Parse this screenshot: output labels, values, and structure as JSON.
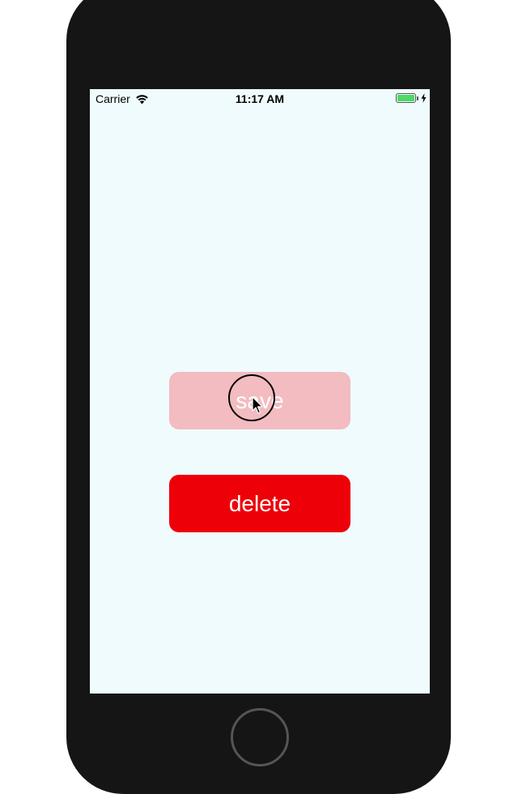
{
  "status_bar": {
    "carrier": "Carrier",
    "time": "11:17 AM",
    "icons": [
      "wifi-icon",
      "battery-icon",
      "charging-bolt-icon"
    ]
  },
  "buttons": {
    "save_label": "save",
    "delete_label": "delete"
  },
  "colors": {
    "screen_background": "#f0fbfd",
    "save_button": "#f2bcc0",
    "delete_button": "#ee0008",
    "battery_fill": "#4cd964",
    "device_frame": "#151515"
  }
}
